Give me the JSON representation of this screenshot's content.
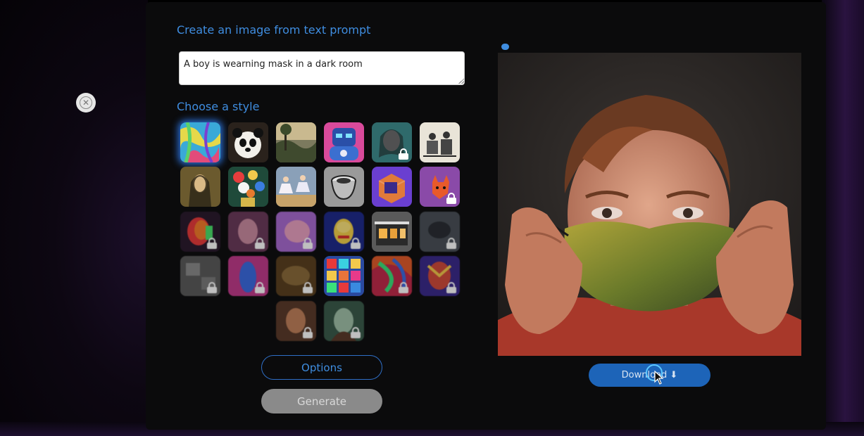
{
  "form": {
    "heading": "Create an image from text prompt",
    "prompt_value": "A boy is wearning mask in a dark room",
    "style_heading": "Choose a style",
    "options_label": "Options",
    "generate_label": "Generate"
  },
  "result": {
    "download_label": "Download ⬇"
  },
  "icons": {
    "close": "close-circle-icon",
    "lock": "lock-icon",
    "cursor": "mouse-pointer-icon"
  },
  "colors": {
    "accent": "#3f8de0",
    "download": "#1d64b8",
    "panel": "#0b0b0c"
  },
  "styles_grid": {
    "rows": 5,
    "tiles_total": 26,
    "selected_index": 0,
    "locked_indices": [
      4,
      11,
      12,
      13,
      14,
      15,
      17,
      18,
      19,
      20,
      21,
      22,
      23,
      24,
      25
    ]
  }
}
